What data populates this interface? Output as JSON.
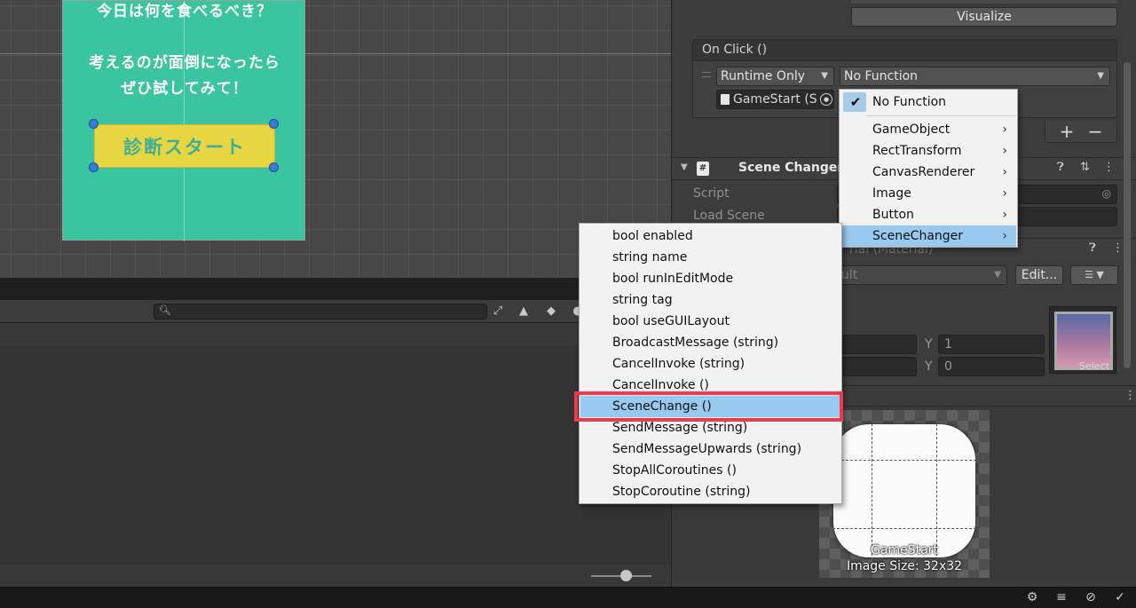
{
  "scene": {
    "card_line1": "今日は何を食べるべき？",
    "card_line2": "考えるのが面倒になったら",
    "card_line3": "ぜひ試してみて！",
    "button_text": "診断スタート",
    "card_color": "#3ac49f",
    "button_color": "#e7d542"
  },
  "inspector": {
    "visualize_label": "Visualize",
    "onclick_header": "On Click ()",
    "runtime_dropdown": "Runtime Only",
    "function_dropdown": "No Function",
    "object_field": "GameStart (S",
    "component_title": "Scene Changer",
    "script_label": "Script",
    "load_scene_label": "Load Scene",
    "material_text": "rial (Material)",
    "shader_text": "ult",
    "edit_label": "Edit...",
    "vec_y_label_1": "Y",
    "vec_y_value_1": "1",
    "vec_y_label_2": "Y",
    "vec_y_value_2": "0",
    "thumb_select": "Select",
    "sprite_name": "GameStart",
    "sprite_size": "Image Size: 32x32"
  },
  "function_menu": {
    "items": [
      {
        "label": "No Function",
        "checked": true,
        "submenu": false
      },
      {
        "label": "GameObject",
        "submenu": true
      },
      {
        "label": "RectTransform",
        "submenu": true
      },
      {
        "label": "CanvasRenderer",
        "submenu": true
      },
      {
        "label": "Image",
        "submenu": true
      },
      {
        "label": "Button",
        "submenu": true
      },
      {
        "label": "SceneChanger",
        "submenu": true,
        "highlighted": true
      }
    ]
  },
  "method_menu": {
    "items": [
      "bool enabled",
      "string name",
      "bool runInEditMode",
      "string tag",
      "bool useGUILayout",
      "BroadcastMessage (string)",
      "CancelInvoke (string)",
      "CancelInvoke ()",
      "SceneChange ()",
      "SendMessage (string)",
      "SendMessageUpwards (string)",
      "StopAllCoroutines ()",
      "StopCoroutine (string)"
    ],
    "highlighted": "SceneChange ()",
    "highlight_color": "#99c9ef",
    "annotation_color": "#ee3a4a"
  },
  "icons": {
    "search": "search-icon",
    "check": "checkmark-icon",
    "chevron": "chevron-right-icon",
    "dropdown": "chevron-down-icon",
    "script": "script-icon",
    "help": "help-icon",
    "settings": "preset-icon",
    "kebab": "more-icon"
  }
}
